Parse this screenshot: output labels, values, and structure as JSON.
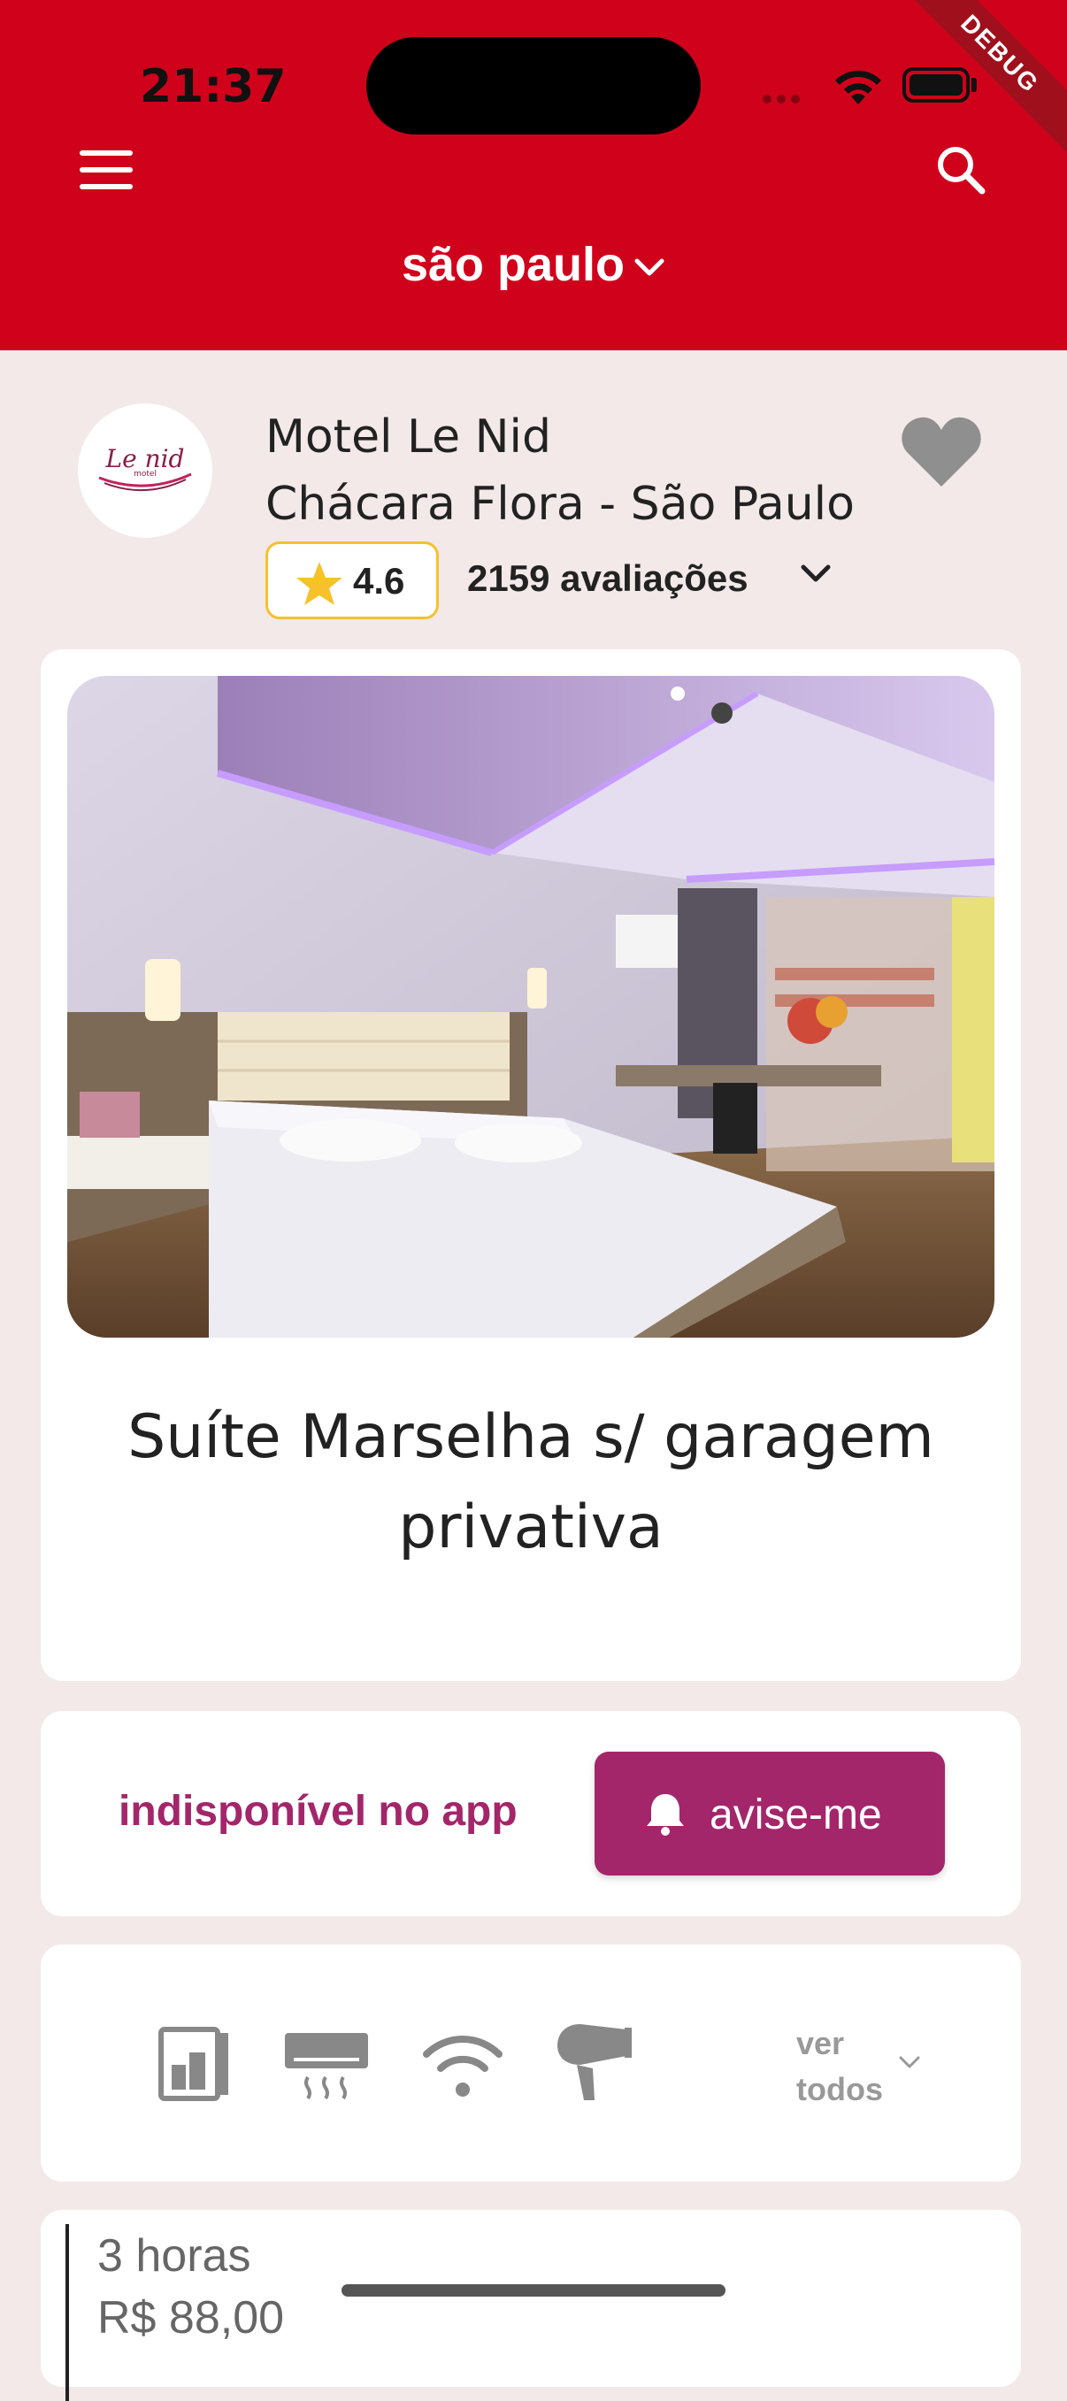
{
  "status_bar": {
    "time": "21:37"
  },
  "debug_banner": "DEBUG",
  "header": {
    "city": "são paulo"
  },
  "motel": {
    "logo_text": "Le nid",
    "logo_subtext": "motel",
    "name": "Motel Le Nid",
    "location": "Chácara Flora - São Paulo",
    "rating": "4.6",
    "reviews": "2159 avaliações"
  },
  "suite": {
    "name": "Suíte Marselha s/ garagem privativa"
  },
  "availability": {
    "status": "indisponível no app",
    "notify_label": "avise-me"
  },
  "amenities": {
    "icons": [
      "frigobar-icon",
      "air-conditioner-icon",
      "wifi-icon",
      "hair-dryer-icon"
    ],
    "see_all": "ver todos"
  },
  "pricing": {
    "duration": "3 horas",
    "price": "R$ 88,00"
  },
  "colors": {
    "brand_red": "#d0021b",
    "accent_magenta": "#a3266a",
    "star_yellow": "#f6c12a",
    "page_background": "#f3e9e9"
  }
}
